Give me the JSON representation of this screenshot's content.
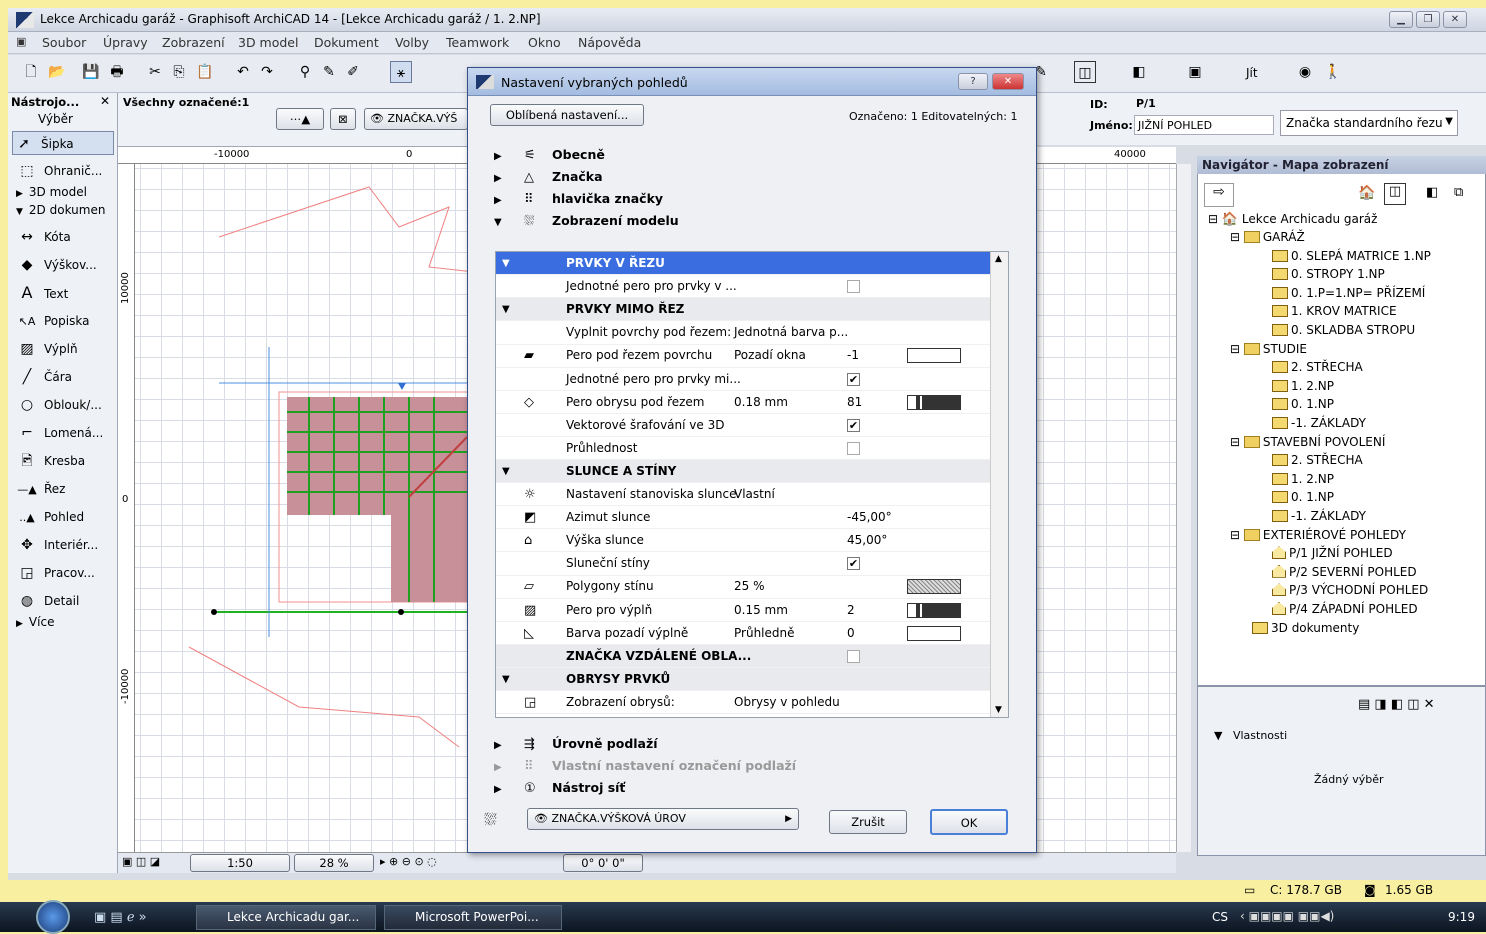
{
  "window": {
    "title": "Lekce Archicadu garáž - Graphisoft ArchiCAD 14 - [Lekce Archicadu garáž / 1. 2.NP]"
  },
  "menu": [
    "Soubor",
    "Úpravy",
    "Zobrazení",
    "3D model",
    "Dokument",
    "Volby",
    "Teamwork",
    "Okno",
    "Nápověda"
  ],
  "toolbar": {
    "go_label": "Jít"
  },
  "toolbox": {
    "title": "Nástrojo...",
    "subtitle": "Výběr",
    "tools": [
      "Šipka",
      "Ohranič...",
      "3D model",
      "2D dokumen",
      "Kóta",
      "Výškov...",
      "Text",
      "Popiska",
      "Výplň",
      "Čára",
      "Oblouk/...",
      "Lomená...",
      "Kresba",
      "Řez",
      "Pohled",
      "Interiér...",
      "Pracov...",
      "Detail",
      "Více"
    ]
  },
  "infobox": {
    "selected": "Všechny označené:1",
    "marker_label": "ZNAČKA.VÝŠ",
    "id_label": "ID:",
    "id_value": "P/1",
    "name_label": "Jméno:",
    "name_value": "JIŽNÍ POHLED",
    "marker_type": "Značka standardního řezu"
  },
  "rulers": {
    "h": [
      "-10000",
      "0",
      "40000"
    ],
    "v": [
      "10000",
      "0",
      "-10000"
    ]
  },
  "statusbar": {
    "scale": "1:50",
    "zoom": "28 %",
    "angle": "0° 0' 0\""
  },
  "navigator": {
    "title": "Navigátor - Mapa zobrazení",
    "project": "Lekce Archicadu garáž",
    "groups": [
      {
        "name": "GARÁŽ",
        "items": [
          "0. SLEPÁ MATRICE 1.NP",
          "0. STROPY 1.NP",
          "0. 1.P=1.NP= PŘÍZEMÍ",
          "1. KROV MATRICE",
          "0. SKLADBA STROPU"
        ]
      },
      {
        "name": "STUDIE",
        "items": [
          "2. STŘECHA",
          "1. 2.NP",
          "0. 1.NP",
          "-1. ZÁKLADY"
        ]
      },
      {
        "name": "STAVEBNÍ POVOLENÍ",
        "items": [
          "2. STŘECHA",
          "1. 2.NP",
          "0. 1.NP",
          "-1. ZÁKLADY"
        ]
      },
      {
        "name": "EXTERIÉROVÉ POHLEDY",
        "items": [
          "P/1 JIŽNÍ POHLED",
          "P/2 SEVERNÍ POHLED",
          "P/3 VÝCHODNÍ POHLED",
          "P/4 ZÁPADNÍ POHLED"
        ]
      }
    ],
    "docs": "3D dokumenty"
  },
  "properties": {
    "title": "Vlastnosti",
    "empty": "Žádný výběr"
  },
  "disk": {
    "c": "C: 178.7 GB",
    "mem": "1.65 GB"
  },
  "dialog": {
    "title": "Nastavení vybraných pohledů",
    "fav_button": "Oblíbená nastavení...",
    "marked": "Označeno: 1 Editovatelných: 1",
    "sections_top": [
      "Obecně",
      "Značka",
      "hlavička značky",
      "Zobrazení modelu"
    ],
    "rows": [
      {
        "type": "sel",
        "label": "PRVKY V ŘEZU"
      },
      {
        "type": "chk",
        "label": "Jednotné pero pro prvky v ...",
        "checked": false
      },
      {
        "type": "hdr",
        "label": "PRVKY MIMO ŘEZ"
      },
      {
        "type": "val",
        "label": "Vyplnit povrchy pod řezem:",
        "value": "Jednotná barva p..."
      },
      {
        "type": "val",
        "label": "Pero pod řezem povrchu",
        "value": "Pozadí okna",
        "num": "-1",
        "swatch": "white"
      },
      {
        "type": "chk",
        "label": "Jednotné pero pro prvky mi...",
        "checked": true
      },
      {
        "type": "val",
        "label": "Pero obrysu pod řezem",
        "value": "0.18 mm",
        "num": "81",
        "swatch": "line"
      },
      {
        "type": "chk",
        "label": "Vektorové šrafování ve 3D",
        "checked": true
      },
      {
        "type": "chk",
        "label": "Průhlednost",
        "checked": false
      },
      {
        "type": "hdr",
        "label": "SLUNCE A STÍNY"
      },
      {
        "type": "val",
        "label": "Nastavení stanoviska slunce",
        "value": "Vlastní"
      },
      {
        "type": "val",
        "label": "Azimut slunce",
        "value": "",
        "num": "-45,00°"
      },
      {
        "type": "val",
        "label": "Výška slunce",
        "value": "",
        "num": "45,00°"
      },
      {
        "type": "chk",
        "label": "Sluneční stíny",
        "checked": true
      },
      {
        "type": "val",
        "label": "Polygony stínu",
        "value": "25 %",
        "swatch": "dots"
      },
      {
        "type": "val",
        "label": "Pero pro výplň",
        "value": "0.15 mm",
        "num": "2",
        "swatch": "line"
      },
      {
        "type": "val",
        "label": "Barva pozadí výplně",
        "value": "Průhledně",
        "num": "0",
        "swatch": "white"
      },
      {
        "type": "chkhdr",
        "label": "ZNAČKA VZDÁLENÉ OBLA...",
        "checked": false
      },
      {
        "type": "hdr",
        "label": "OBRYSY PRVKŮ"
      },
      {
        "type": "val",
        "label": "Zobrazení obrysů:",
        "value": "Obrysy v pohledu"
      }
    ],
    "sections_bottom": [
      "Úrovně podlaží",
      "Vlastní nastavení označení podlaží",
      "Nástroj síť"
    ],
    "marker_select": "ZNAČKA.VÝŠKOVÁ ÚROV",
    "cancel": "Zrušit",
    "ok": "OK"
  },
  "taskbar": {
    "items": [
      "Lekce Archicadu gar...",
      "Microsoft PowerPoi..."
    ],
    "lang": "CS",
    "time": "9:19"
  }
}
